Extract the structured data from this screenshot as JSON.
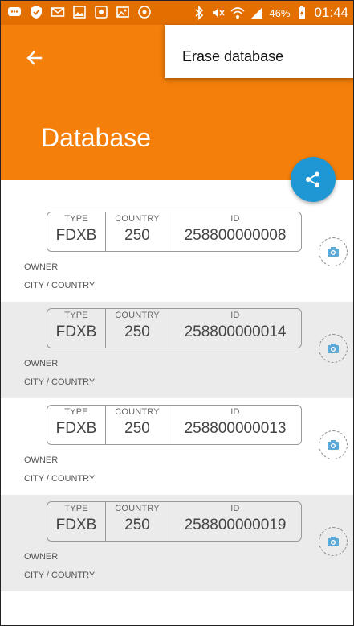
{
  "status_bar": {
    "battery_percent": "46%",
    "time": "01:44",
    "icons": [
      "chat-icon",
      "shield-icon",
      "mail-icon",
      "image-icon",
      "app-icon",
      "photo-icon",
      "alert-icon",
      "bluetooth-icon",
      "mute-icon",
      "wifi-icon",
      "signal-icon",
      "battery-icon"
    ]
  },
  "appbar": {
    "title": "Database",
    "back_icon": "arrow-left-icon",
    "accent_color": "#f47f0a"
  },
  "menu": {
    "items": [
      "Erase database"
    ]
  },
  "fab": {
    "icon": "share-icon",
    "color": "#1e97d4"
  },
  "list": {
    "labels": {
      "type": "TYPE",
      "country": "COUNTRY",
      "id": "ID",
      "owner": "OWNER",
      "city": "CITY / COUNTRY"
    },
    "items": [
      {
        "type": "FDXB",
        "country": "250",
        "id": "258800000008"
      },
      {
        "type": "FDXB",
        "country": "250",
        "id": "258800000014"
      },
      {
        "type": "FDXB",
        "country": "250",
        "id": "258800000013"
      },
      {
        "type": "FDXB",
        "country": "250",
        "id": "258800000019"
      }
    ]
  }
}
